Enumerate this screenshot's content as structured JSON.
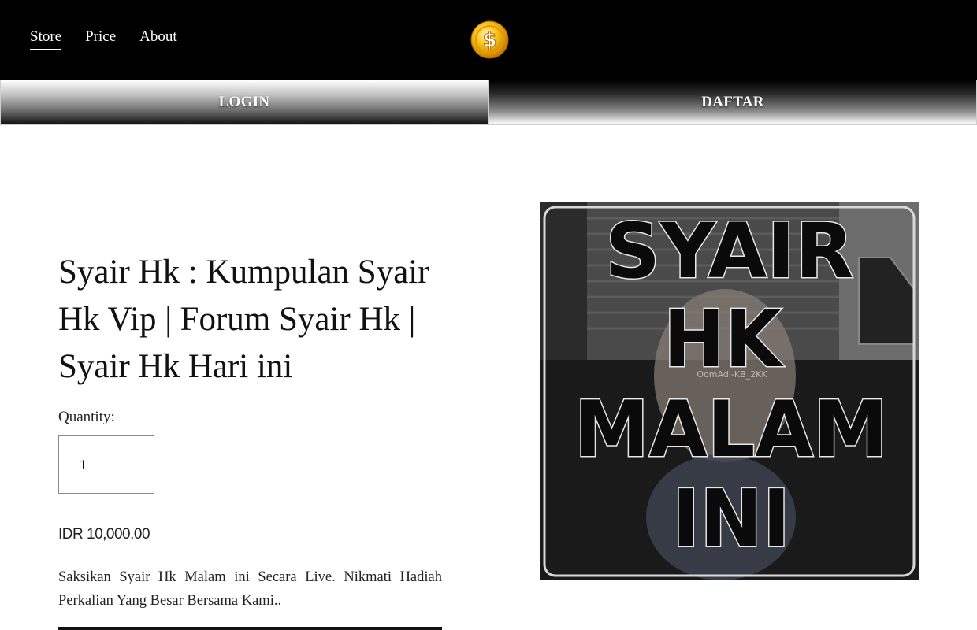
{
  "nav": {
    "items": [
      {
        "label": "Store",
        "active": true
      },
      {
        "label": "Price",
        "active": false
      },
      {
        "label": "About",
        "active": false
      }
    ],
    "logo_icon": "gold-dollar-coin-icon"
  },
  "auth": {
    "login_label": "LOGIN",
    "daftar_label": "DAFTAR"
  },
  "product": {
    "title": "Syair Hk : Kumpulan Syair Hk Vip | Forum Syair Hk | Syair Hk Hari ini",
    "quantity_label": "Quantity:",
    "quantity_value": "1",
    "price": "IDR 10,000.00",
    "description": "Saksikan Syair Hk Malam ini Secara Live. Nikmati Hadiah Perkalian Yang Besar Bersama Kami..",
    "image": {
      "lines": [
        "SYAIR",
        "HK",
        "MALAM",
        "INI"
      ],
      "watermark": "OomAdi-KB_2KK"
    }
  },
  "colors": {
    "header_bg": "#000000",
    "coin_gold": "#f5b400",
    "text": "#111111"
  }
}
